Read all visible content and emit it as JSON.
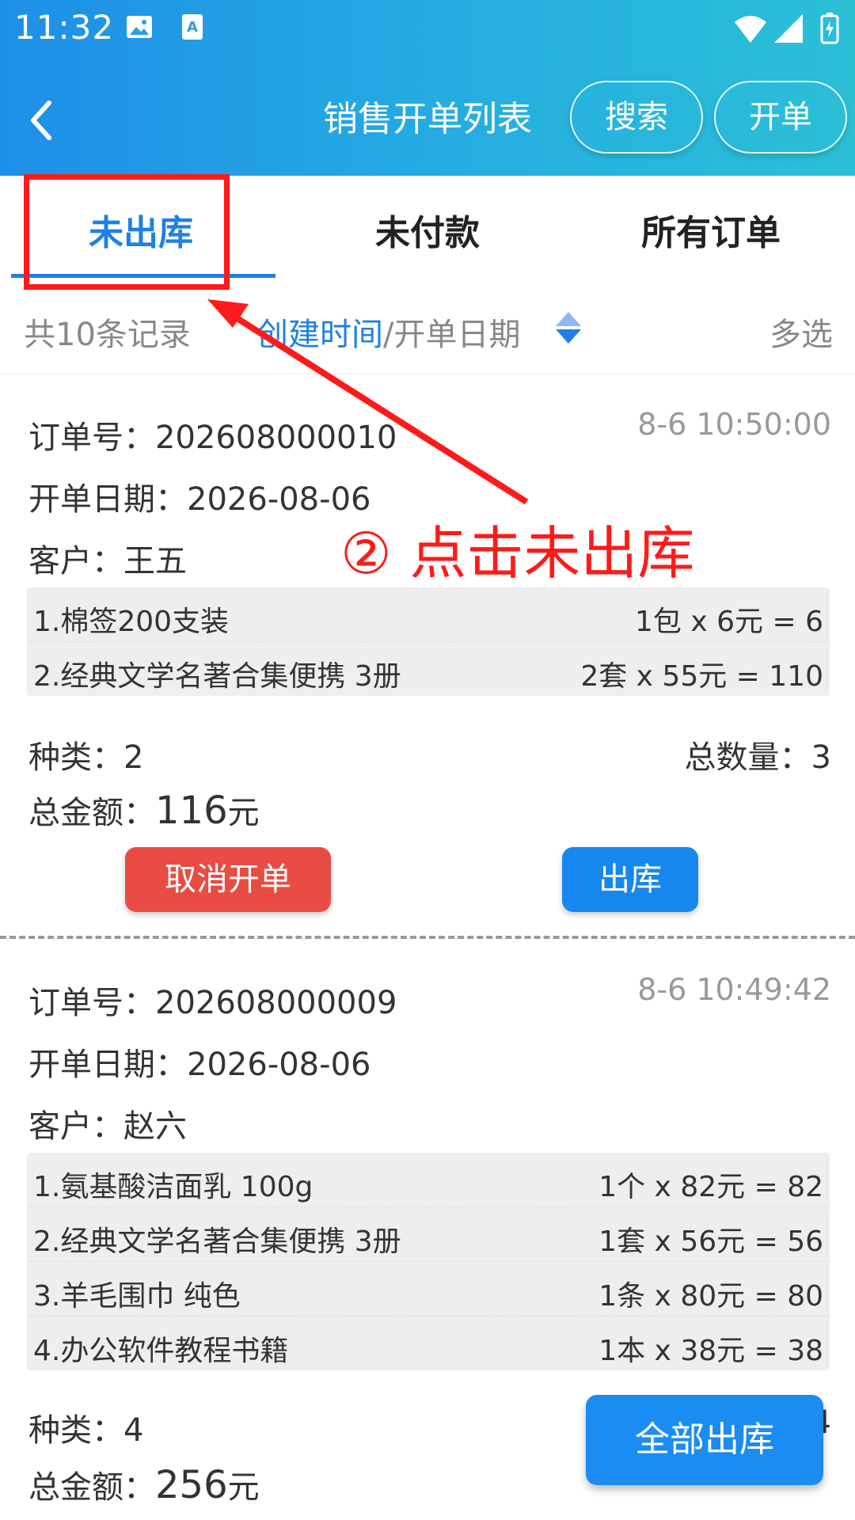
{
  "status_bar": {
    "time": "11:32"
  },
  "header": {
    "title": "销售开单列表",
    "search_label": "搜索",
    "create_label": "开单"
  },
  "tabs": [
    {
      "label": "未出库",
      "active": true
    },
    {
      "label": "未付款",
      "active": false
    },
    {
      "label": "所有订单",
      "active": false
    }
  ],
  "filter": {
    "count_text": "共10条记录",
    "sort_active": "创建时间",
    "sort_rest": "/开单日期",
    "multi_select": "多选"
  },
  "orders": [
    {
      "order_label": "订单号：",
      "order_no": "202608000010",
      "time": "8-6 10:50:00",
      "date_label": "开单日期：",
      "date": "2026-08-06",
      "customer_label": "客户：",
      "customer": "王五",
      "items": [
        {
          "name": "1.棉签200支装",
          "calc": "1包 x 6元 = 6"
        },
        {
          "name": "2.经典文学名著合集便携 3册",
          "calc": "2套 x 55元 = 110"
        }
      ],
      "kinds_label": "种类：",
      "kinds": "2",
      "qty_label": "总数量：",
      "qty": "3",
      "total_label": "总金额：",
      "total": "116",
      "total_unit": "元",
      "cancel_label": "取消开单",
      "ship_label": "出库"
    },
    {
      "order_label": "订单号：",
      "order_no": "202608000009",
      "time": "8-6 10:49:42",
      "date_label": "开单日期：",
      "date": "2026-08-06",
      "customer_label": "客户：",
      "customer": "赵六",
      "items": [
        {
          "name": "1.氨基酸洁面乳 100g",
          "calc": "1个 x 82元 = 82"
        },
        {
          "name": "2.经典文学名著合集便携 3册",
          "calc": "1套 x 56元 = 56"
        },
        {
          "name": "3.羊毛围巾 纯色",
          "calc": "1条 x 80元 = 80"
        },
        {
          "name": "4.办公软件教程书籍",
          "calc": "1本 x 38元 = 38"
        }
      ],
      "kinds_label": "种类：",
      "kinds": "4",
      "qty_partial": "4",
      "total_label": "总金额：",
      "total": "256",
      "total_unit": "元"
    }
  ],
  "fab_label": "全部出库",
  "annotation": {
    "text": "② 点击未出库",
    "color": "#ff1a1a"
  },
  "colors": {
    "accent": "#1f7fe6",
    "danger": "#e84c43",
    "header_start": "#1e8fe8",
    "header_end": "#2bbfd6"
  }
}
